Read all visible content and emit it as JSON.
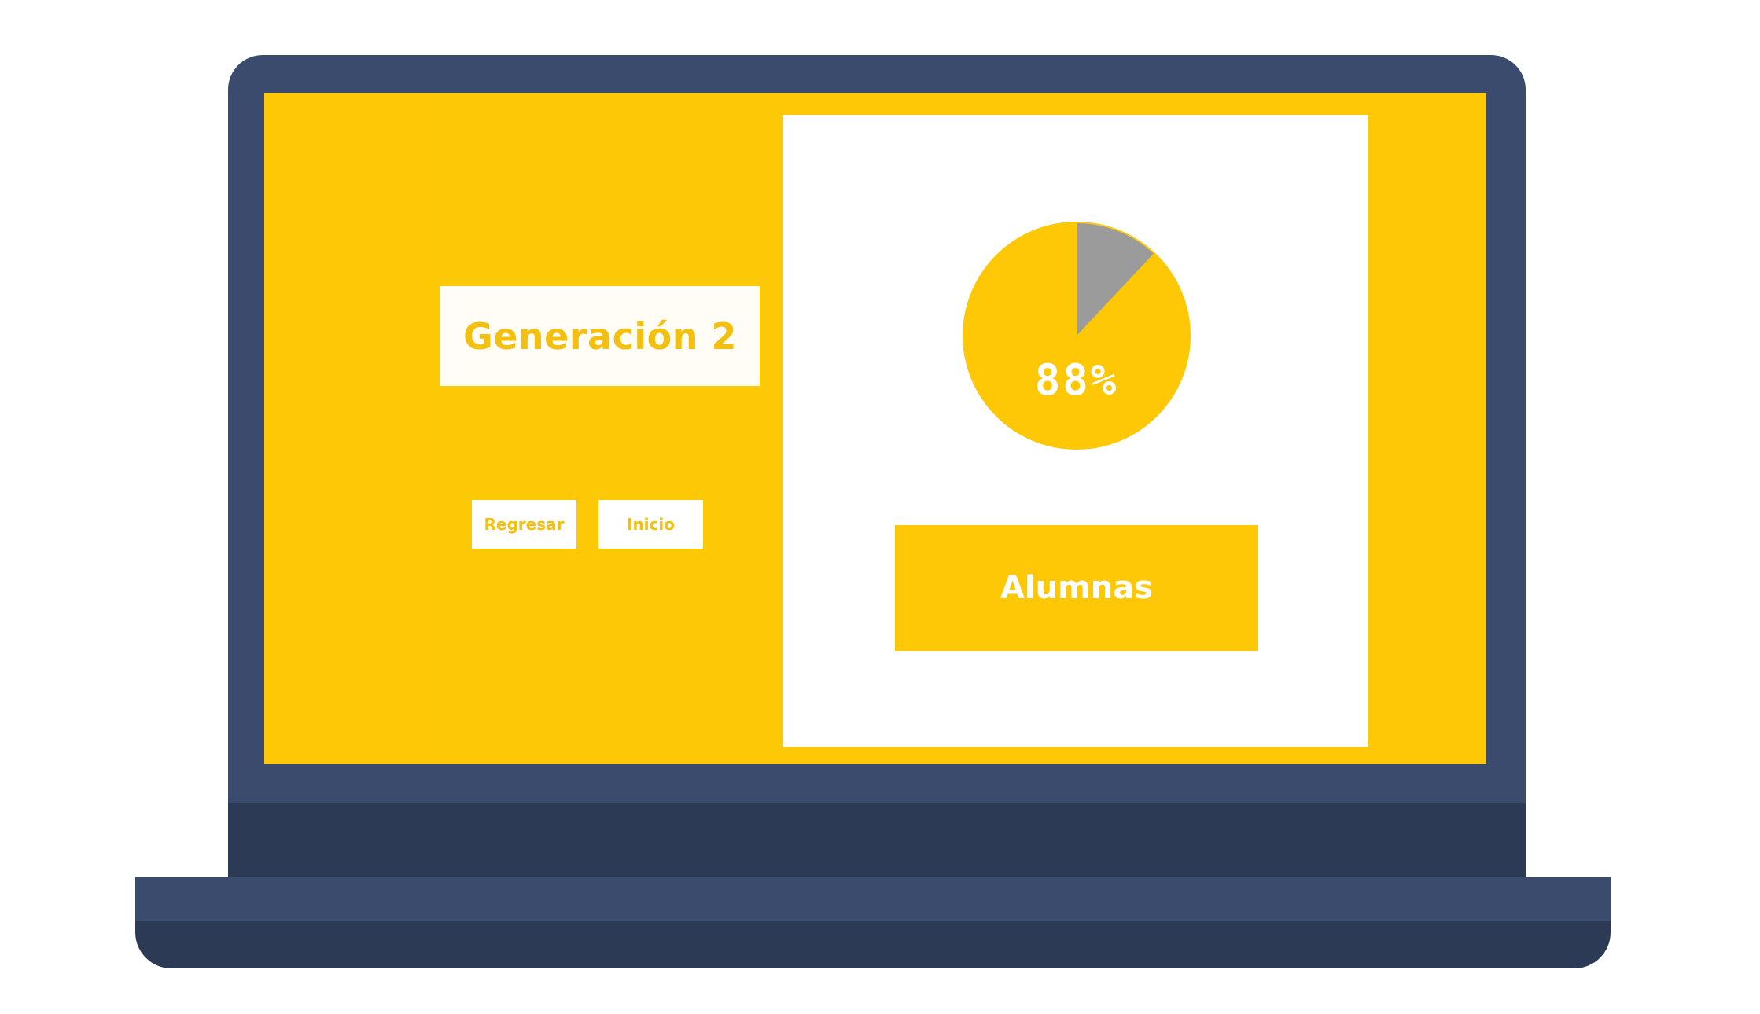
{
  "header": {
    "title": "Generación 2"
  },
  "nav": {
    "back_label": "Regresar",
    "home_label": "Inicio"
  },
  "stats": {
    "percent_label": "88%",
    "percent_value": 88
  },
  "actions": {
    "alumnas_label": "Alumnas"
  },
  "colors": {
    "accent": "#fec807",
    "laptop_frame": "#3b4b6e",
    "laptop_frame_dark": "#2d3a56",
    "pie_remainder": "#9b9b9b",
    "panel": "#ffffff"
  }
}
